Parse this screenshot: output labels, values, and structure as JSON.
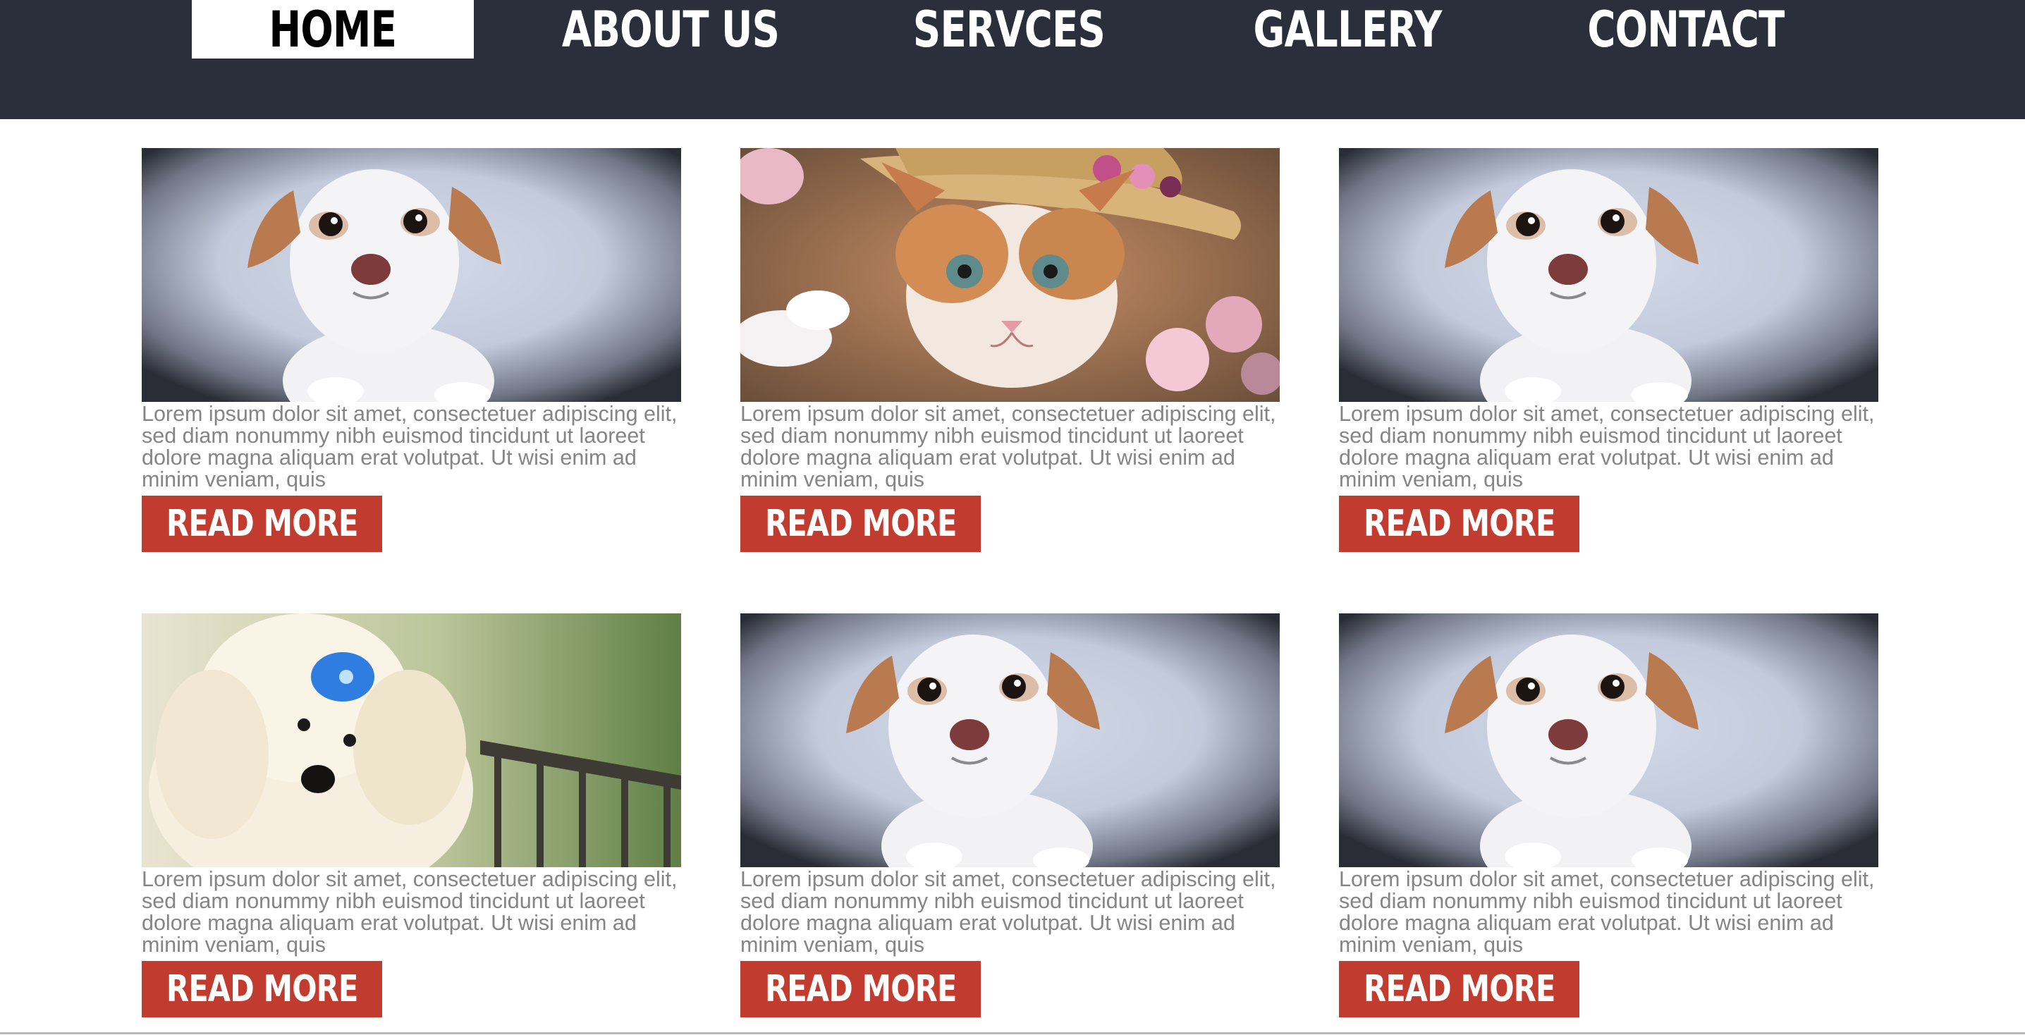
{
  "nav": {
    "items": [
      {
        "label": "HOME",
        "active": true
      },
      {
        "label": "ABOUT US",
        "active": false
      },
      {
        "label": "SERVCES",
        "active": false
      },
      {
        "label": "GALLERY",
        "active": false
      },
      {
        "label": "CONTACT",
        "active": false
      }
    ]
  },
  "cards": [
    {
      "image": "dog-photo",
      "text": "Lorem ipsum dolor sit amet, consectetuer adipiscing elit, sed diam nonummy nibh euismod tincidunt ut laoreet dolore magna aliquam erat volutpat. Ut wisi enim ad minim veniam, quis",
      "button": "READ MORE"
    },
    {
      "image": "kitten-photo",
      "text": "Lorem ipsum dolor sit amet, consectetuer adipiscing elit, sed diam nonummy nibh euismod tincidunt ut laoreet dolore magna aliquam erat volutpat. Ut wisi enim ad minim veniam, quis",
      "button": "READ MORE"
    },
    {
      "image": "dog-photo",
      "text": "Lorem ipsum dolor sit amet, consectetuer adipiscing elit, sed diam nonummy nibh euismod tincidunt ut laoreet dolore magna aliquam erat volutpat. Ut wisi enim ad minim veniam, quis",
      "button": "READ MORE"
    },
    {
      "image": "puppy-photo",
      "text": "Lorem ipsum dolor sit amet, consectetuer adipiscing elit, sed diam nonummy nibh euismod tincidunt ut laoreet dolore magna aliquam erat volutpat. Ut wisi enim ad minim veniam, quis",
      "button": "READ MORE"
    },
    {
      "image": "dog-photo",
      "text": "Lorem ipsum dolor sit amet, consectetuer adipiscing elit, sed diam nonummy nibh euismod tincidunt ut laoreet dolore magna aliquam erat volutpat. Ut wisi enim ad minim veniam, quis",
      "button": "READ MORE"
    },
    {
      "image": "dog-photo",
      "text": "Lorem ipsum dolor sit amet, consectetuer adipiscing elit, sed diam nonummy nibh euismod tincidunt ut laoreet dolore magna aliquam erat volutpat. Ut wisi enim ad minim veniam, quis",
      "button": "READ MORE"
    }
  ],
  "colors": {
    "navbar": "#2b2e3b",
    "button": "#c23b2f",
    "text": "#858585"
  }
}
